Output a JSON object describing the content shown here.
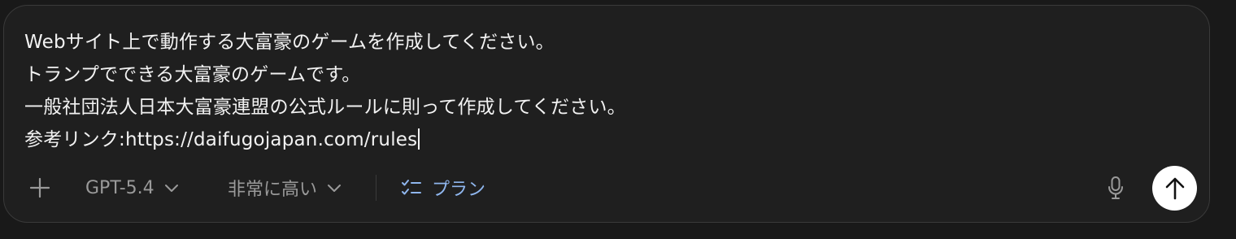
{
  "prompt": {
    "lines": [
      "Webサイト上で動作する大富豪のゲームを作成してください。",
      "トランプでできる大富豪のゲームです。",
      "一般社団法人日本大富豪連盟の公式ルールに則って作成してください。",
      "参考リンク:https://daifugojapan.com/rules"
    ]
  },
  "toolbar": {
    "model_label": "GPT-5.4",
    "effort_label": "非常に高い",
    "plan_label": "プラン"
  },
  "icons": {
    "plus": "plus-icon",
    "model_chevron": "chevron-down-icon",
    "effort_chevron": "chevron-down-icon",
    "plan": "checklist-icon",
    "mic": "microphone-icon",
    "send": "arrow-up-icon"
  },
  "colors": {
    "background": "#191919",
    "composer": "#1f1f1f",
    "text": "#f2f2f2",
    "muted": "#9a9a9a",
    "accent": "#8fb6ee",
    "send_button": "#ffffff"
  }
}
